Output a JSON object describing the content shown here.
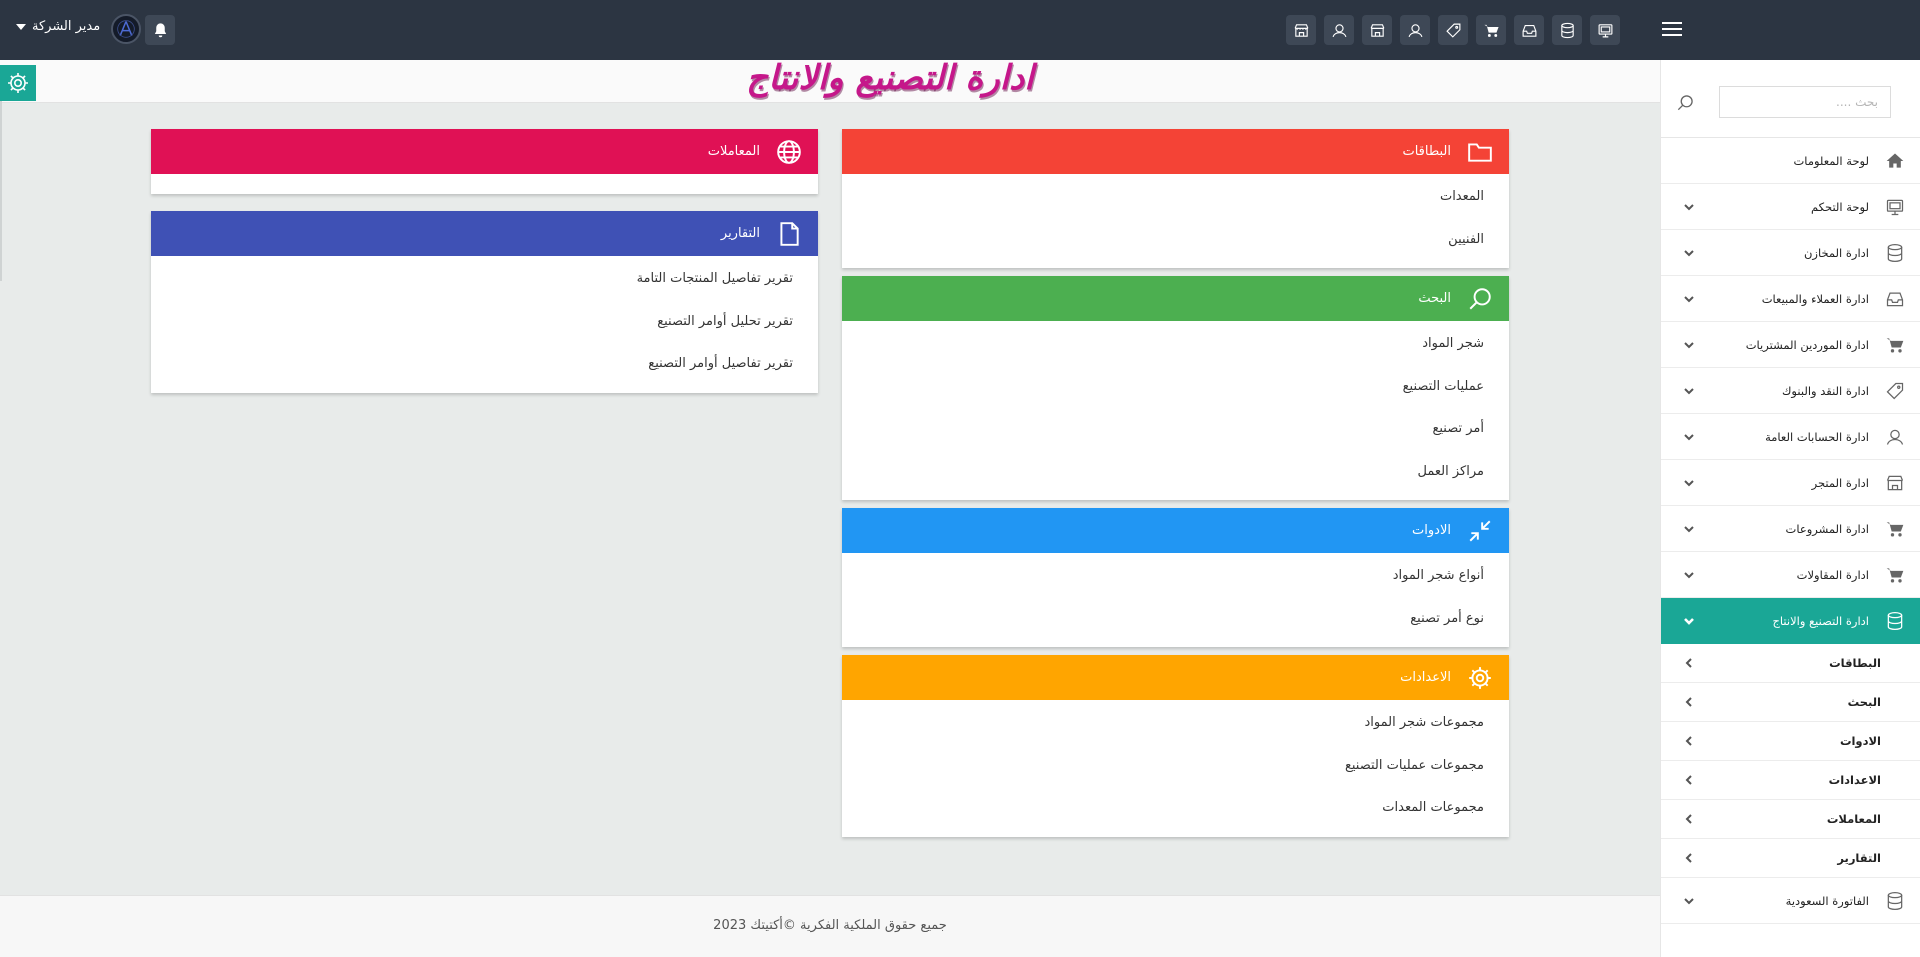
{
  "topbar": {
    "user_name": "مدير الشركة",
    "icons": [
      "monitor-icon",
      "database-icon",
      "inbox-icon",
      "cart-icon",
      "tag-icon",
      "user-icon",
      "store-icon",
      "user-icon",
      "store-icon"
    ]
  },
  "page": {
    "title": "ادارة التصنيع والانتاج"
  },
  "cards": {
    "cards_section": {
      "title": "البطاقات",
      "color": "#f44336",
      "items": [
        "المعدات",
        "الفنيين"
      ]
    },
    "search_section": {
      "title": "البحث",
      "color": "#4caf50",
      "items": [
        "شجر المواد",
        "عمليات التصنيع",
        "أمر تصنيع",
        "مراكز العمل"
      ]
    },
    "tools_section": {
      "title": "الادوات",
      "color": "#2196f3",
      "items": [
        "أنواع شجر المواد",
        "نوع أمر تصنيع"
      ]
    },
    "settings_section": {
      "title": "الاعدادات",
      "color": "#ffa500",
      "items": [
        "مجموعات شجر المواد",
        "مجموعات عمليات التصنيع",
        "مجموعات المعدات"
      ]
    },
    "transactions_section": {
      "title": "المعاملات",
      "color": "#e01155",
      "items": []
    },
    "reports_section": {
      "title": "التقارير",
      "color": "#3f51b5",
      "items": [
        "تقرير تفاصيل المنتجات التامة",
        "تقرير تحليل أوامر التصنيع",
        "تقرير تفاصيل أوامر التصنيع"
      ]
    }
  },
  "sidebar": {
    "search_placeholder": "بحث ....",
    "active_color": "#1aa796",
    "items": [
      {
        "label": "لوحة المعلومات",
        "icon": "home-icon"
      },
      {
        "label": "لوحة التحكم",
        "icon": "monitor-icon"
      },
      {
        "label": "ادارة المخازن",
        "icon": "database-icon"
      },
      {
        "label": "ادارة العملاء والمبيعات",
        "icon": "inbox-icon"
      },
      {
        "label": "ادارة الموردين المشتريات",
        "icon": "cart-icon"
      },
      {
        "label": "ادارة النقد والبنوك",
        "icon": "tag-icon"
      },
      {
        "label": "ادارة الحسابات العامة",
        "icon": "user-icon"
      },
      {
        "label": "ادارة المتجر",
        "icon": "store-icon"
      },
      {
        "label": "ادارة المشروعات",
        "icon": "cart-icon"
      },
      {
        "label": "ادارة المقاولات",
        "icon": "cart-icon"
      },
      {
        "label": "ادارة التصنيع والانتاج",
        "icon": "database-icon"
      }
    ],
    "sub_items": [
      "البطاقات",
      "البحث",
      "الادوات",
      "الاعدادات",
      "المعاملات",
      "التقارير"
    ],
    "last_item": {
      "label": "الفاتورة السعودية",
      "icon": "database-icon"
    }
  },
  "footer": {
    "text": "جميع حقوق الملكية الفكرية ©أكتيتك 2023"
  }
}
